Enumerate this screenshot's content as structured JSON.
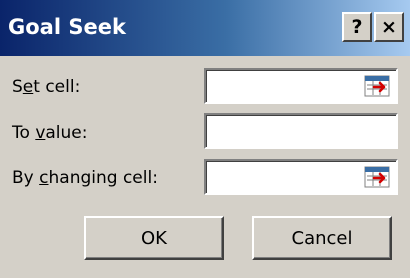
{
  "window": {
    "title": "Goal Seek",
    "help_label": "?",
    "close_label": "×"
  },
  "fields": [
    {
      "pre": "S",
      "accel": "e",
      "post": "t cell:",
      "value": "",
      "has_ref_button": true
    },
    {
      "pre": "To ",
      "accel": "v",
      "post": "alue:",
      "value": "",
      "has_ref_button": false
    },
    {
      "pre": "By ",
      "accel": "c",
      "post": "hanging cell:",
      "value": "",
      "has_ref_button": true
    }
  ],
  "buttons": {
    "ok_label": "OK",
    "cancel_label": "Cancel"
  },
  "icons": {
    "ref_button": "collapse-dialog-icon"
  },
  "colors": {
    "title_start": "#0a246a",
    "title_end": "#a6caf0",
    "face": "#d4d0c8"
  }
}
